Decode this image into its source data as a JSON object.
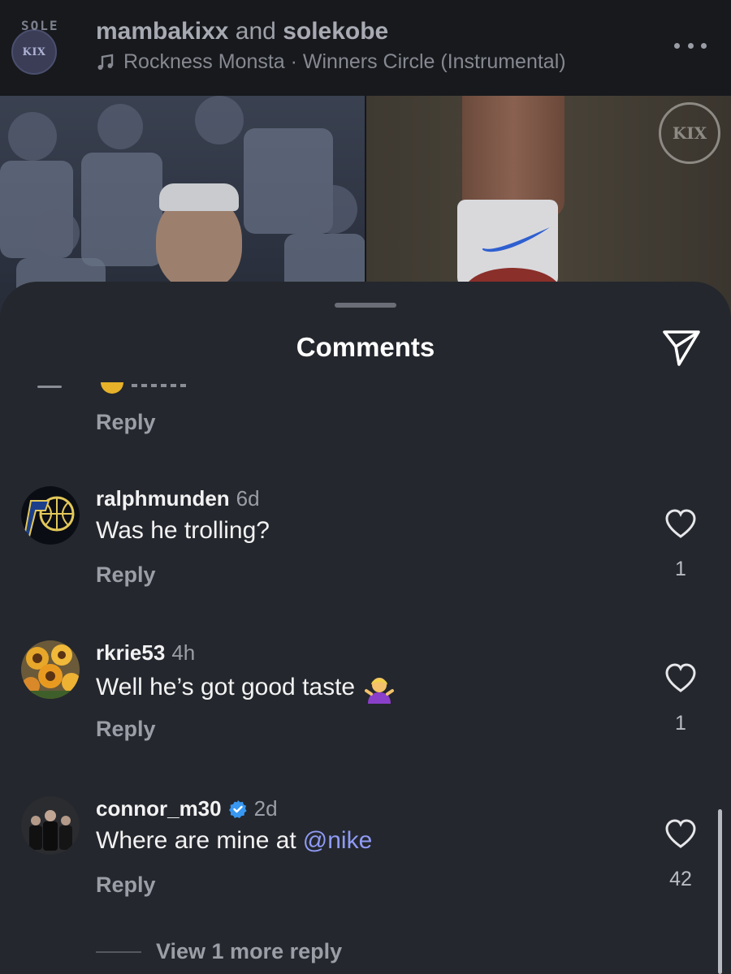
{
  "header": {
    "account_1": "mambakixx",
    "conjunction": "and",
    "account_2": "solekobe",
    "audio": "Rockness Monsta · Winners Circle (Instrumental)",
    "avatar_text": "KIX",
    "avatar_badge": "SOLE"
  },
  "media": {
    "watermark_text": "KIX"
  },
  "comments_sheet": {
    "title": "Comments",
    "previous_reply_label": "Reply",
    "comments": [
      {
        "username": "ralphmunden",
        "time": "6d",
        "text": "Was he trolling?",
        "reply_label": "Reply",
        "likes": "1",
        "avatar": "pacers-logo"
      },
      {
        "username": "rkrie53",
        "time": "4h",
        "text": "Well he’s got good taste",
        "emoji": "woman-shrugging-emoji",
        "reply_label": "Reply",
        "likes": "1",
        "avatar": "sunflowers-photo"
      },
      {
        "username": "connor_m30",
        "verified": true,
        "time": "2d",
        "text": "Where are mine at",
        "mention": "@nike",
        "reply_label": "Reply",
        "likes": "42",
        "avatar": "team-photo"
      }
    ],
    "view_more": "View 1 more reply"
  },
  "colors": {
    "sheet_bg": "#24272d",
    "mention": "#8f9bf5",
    "verified_badge": "#3897f0"
  }
}
